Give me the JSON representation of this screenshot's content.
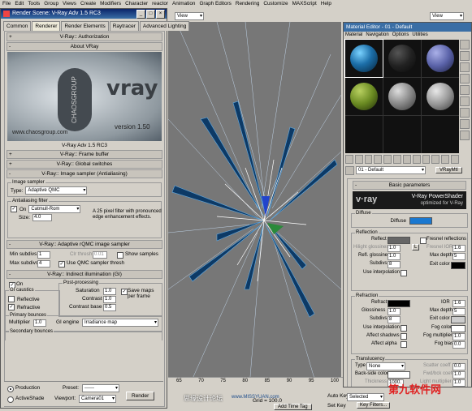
{
  "menubar": [
    "File",
    "Edit",
    "Tools",
    "Group",
    "Views",
    "Create",
    "Modifiers",
    "Character",
    "reactor",
    "Animation",
    "Graph Editors",
    "Rendering",
    "Customize",
    "MAXScript",
    "Help"
  ],
  "toolbar": {
    "view_dropdown": "View",
    "view_dropdown2": "View"
  },
  "render_scene": {
    "title": "Render Scene: V-Ray Adv 1.5 RC3",
    "tabs": [
      "Common",
      "Renderer",
      "Render Elements",
      "Raytracer",
      "Advanced Lighting"
    ],
    "rollouts": {
      "authorization": "V-Ray:: Authorization",
      "about": "About VRay",
      "frame_buffer": "V-Ray:: Frame buffer",
      "global_switches": "V-Ray:: Global switches",
      "image_sampler": "V-Ray:: Image sampler (Antialiasing)",
      "adaptive": "V-Ray:: Adaptive rQMC image sampler",
      "indirect": "V-Ray:: Indirect illumination (GI)"
    },
    "splash": {
      "brand": "CHAOSGROUP",
      "logo": "vray",
      "version": "version 1.50",
      "url": "www.chaosgroup.com"
    },
    "about_text": "V-Ray Adv 1.5 RC3",
    "image_sampler": {
      "group": "Image sampler",
      "type_label": "Type:",
      "type_value": "Adaptive QMC"
    },
    "aa_filter": {
      "group": "Antialiasing filter",
      "on_label": "On",
      "filter": "Catmull-Rom",
      "size_label": "Size:",
      "size_value": "4.0",
      "desc": "A 25 pixel filter with pronounced edge enhancement effects."
    },
    "adaptive": {
      "min_label": "Min subdivs",
      "min_value": "1",
      "max_label": "Max subdivs",
      "max_value": "4",
      "clr_label": "Clr thresh",
      "clr_value": "0.01",
      "show_samples": "Show samples",
      "use_qmc": "Use QMC sampler thresh"
    },
    "gi": {
      "on_label": "On",
      "caustics_group": "GI caustics",
      "reflective": "Reflective",
      "refractive": "Refractive",
      "post_group": "Post-processing",
      "saturation_label": "Saturation",
      "saturation_value": "1.0",
      "contrast_label": "Contrast",
      "contrast_value": "1.0",
      "contrast_base_label": "Contrast base",
      "contrast_base_value": "0.5",
      "save_maps": "Save maps per frame",
      "primary_group": "Primary bounces",
      "multiplier_label": "Multiplier",
      "multiplier_value": "1.0",
      "engine_label": "GI engine",
      "engine_value": "Irradiance map",
      "secondary_group": "Secondary bounces"
    },
    "footer": {
      "production": "Production",
      "activeshade": "ActiveShade",
      "preset_label": "Preset:",
      "preset_value": "------",
      "viewport_label": "Viewport:",
      "viewport_value": "Camera01",
      "render_button": "Render"
    }
  },
  "material_editor": {
    "title": "Material Editor - 01 - Default",
    "menu": [
      "Material",
      "Navigation",
      "Options",
      "Utilities"
    ],
    "name_value": "01 - Default",
    "type_button": "VRayMtl",
    "basic_params": "Basic parameters",
    "banner": {
      "logo": "v·ray",
      "line1": "V-Ray PowerShader",
      "line2": "optimized for V-Ray"
    },
    "diffuse": {
      "group": "Diffuse",
      "label": "Diffuse"
    },
    "reflection": {
      "group": "Reflection",
      "reflect": "Reflect",
      "hilight": "Hilight glossiness",
      "hilight_value": "1.0",
      "refl_gloss": "Refl. glossiness",
      "refl_gloss_value": "1.0",
      "subdivs": "Subdivs",
      "subdivs_value": "8",
      "interp": "Use interpolation",
      "fresnel": "Fresnel reflections",
      "fresnel_ior": "Fresnel IOR",
      "fresnel_ior_value": "1.6",
      "max_depth": "Max depth",
      "max_depth_value": "5",
      "exit_color": "Exit color",
      "l_button": "L"
    },
    "refraction": {
      "group": "Refraction",
      "refract": "Refract",
      "glossiness": "Glossiness",
      "glossiness_value": "1.0",
      "subdivs": "Subdivs",
      "subdivs_value": "8",
      "interp": "Use interpolation",
      "shadows": "Affect shadows",
      "alpha": "Affect alpha",
      "ior": "IOR",
      "ior_value": "1.6",
      "max_depth": "Max depth",
      "max_depth_value": "5",
      "exit_color": "Exit color",
      "fog_color": "Fog color",
      "fog_mult": "Fog multiplier",
      "fog_mult_value": "1.0",
      "fog_bias": "Fog bias",
      "fog_bias_value": "0.0"
    },
    "translucency": {
      "group": "Translucency",
      "type_label": "Type",
      "type_value": "None",
      "back_color": "Back-side color",
      "thickness": "Thickness",
      "thickness_value": "1000.",
      "scatter": "Scatter coeff",
      "scatter_value": "0.0",
      "fwd_bck": "Fwd/bck coeff",
      "fwd_bck_value": "1.0",
      "light_mult": "Light multiplier",
      "light_mult_value": "1.0"
    }
  },
  "viewport": {
    "ruler_ticks": [
      "65",
      "70",
      "75",
      "80",
      "85",
      "90",
      "95",
      "100"
    ]
  },
  "status": {
    "grid": "Grid = 100.0",
    "add_time_tag": "Add Time Tag",
    "auto_key": "Auto Key",
    "selected": "Selected",
    "set_key": "Set Key",
    "key_filters": "Key Filters..."
  },
  "watermarks": {
    "cn1": "思缘设计论坛",
    "url": "www.MISSYUAN.com",
    "cn2": "第九软件网"
  }
}
